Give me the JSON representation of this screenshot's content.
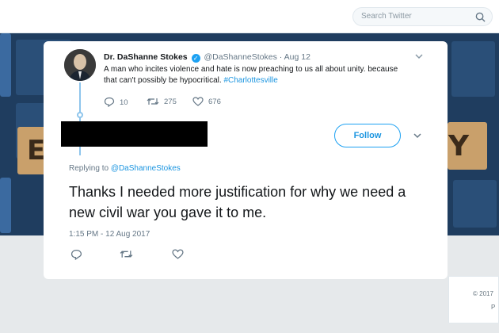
{
  "search": {
    "placeholder": "Search Twitter"
  },
  "parent_tweet": {
    "name": "Dr. DaShanne Stokes",
    "handle": "@DaShanneStokes",
    "date": "Aug 12",
    "text_before": "A man who incites violence and hate is now preaching to us all about unity. because that can't possibly be hypocritical. ",
    "hashtag": "#Charlottesville",
    "replies": "10",
    "retweets": "275",
    "likes": "676"
  },
  "main_tweet": {
    "follow_label": "Follow",
    "replying_prefix": "Replying to ",
    "replying_handle": "@DaShanneStokes",
    "text": "Thanks I needed more justification for why we need a new civil war you gave it to me.",
    "timestamp": "1:15 PM - 12 Aug 2017"
  },
  "footer": {
    "copyright": "© 2017",
    "p": "P"
  },
  "colors": {
    "accent": "#1da1f2",
    "link": "#1b95e0",
    "muted": "#657786"
  },
  "icons": [
    "search-icon",
    "verified-icon",
    "chevron-down-icon",
    "reply-icon",
    "retweet-icon",
    "like-icon"
  ]
}
